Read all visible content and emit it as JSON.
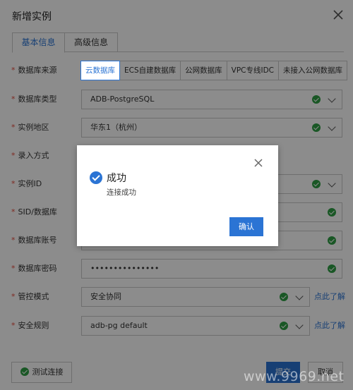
{
  "dialog": {
    "title": "新增实例",
    "tabs": [
      {
        "label": "基本信息",
        "active": true
      },
      {
        "label": "高级信息",
        "active": false
      }
    ]
  },
  "form": {
    "source": {
      "label": "数据库来源",
      "options": [
        "云数据库",
        "ECS自建数据库",
        "公网数据库",
        "VPC专线IDC",
        "未接入公网数据库"
      ],
      "selected": "云数据库"
    },
    "db_type": {
      "label": "数据库类型",
      "value": "ADB-PostgreSQL"
    },
    "region": {
      "label": "实例地区",
      "value": "华东1（杭州）"
    },
    "entry_mode": {
      "label": "录入方式"
    },
    "instance_id": {
      "label": "实例ID"
    },
    "sid": {
      "label": "SID/数据库"
    },
    "account": {
      "label": "数据库账号"
    },
    "password": {
      "label": "数据库密码",
      "value": "•••••••••••••••"
    },
    "control_mode": {
      "label": "管控模式",
      "value": "安全协同",
      "help": "点此了解"
    },
    "security_rule": {
      "label": "安全规则",
      "value": "adb-pg default",
      "help": "点此了解"
    }
  },
  "footer": {
    "test_label": "测试连接",
    "submit_label": "提交",
    "cancel_label": "取消"
  },
  "modal": {
    "title": "成功",
    "message": "连接成功",
    "ok_label": "确认"
  },
  "watermark": "www.9969.net",
  "colors": {
    "primary": "#2b74d4",
    "success": "#2f9e44",
    "required": "#e64b3c"
  }
}
